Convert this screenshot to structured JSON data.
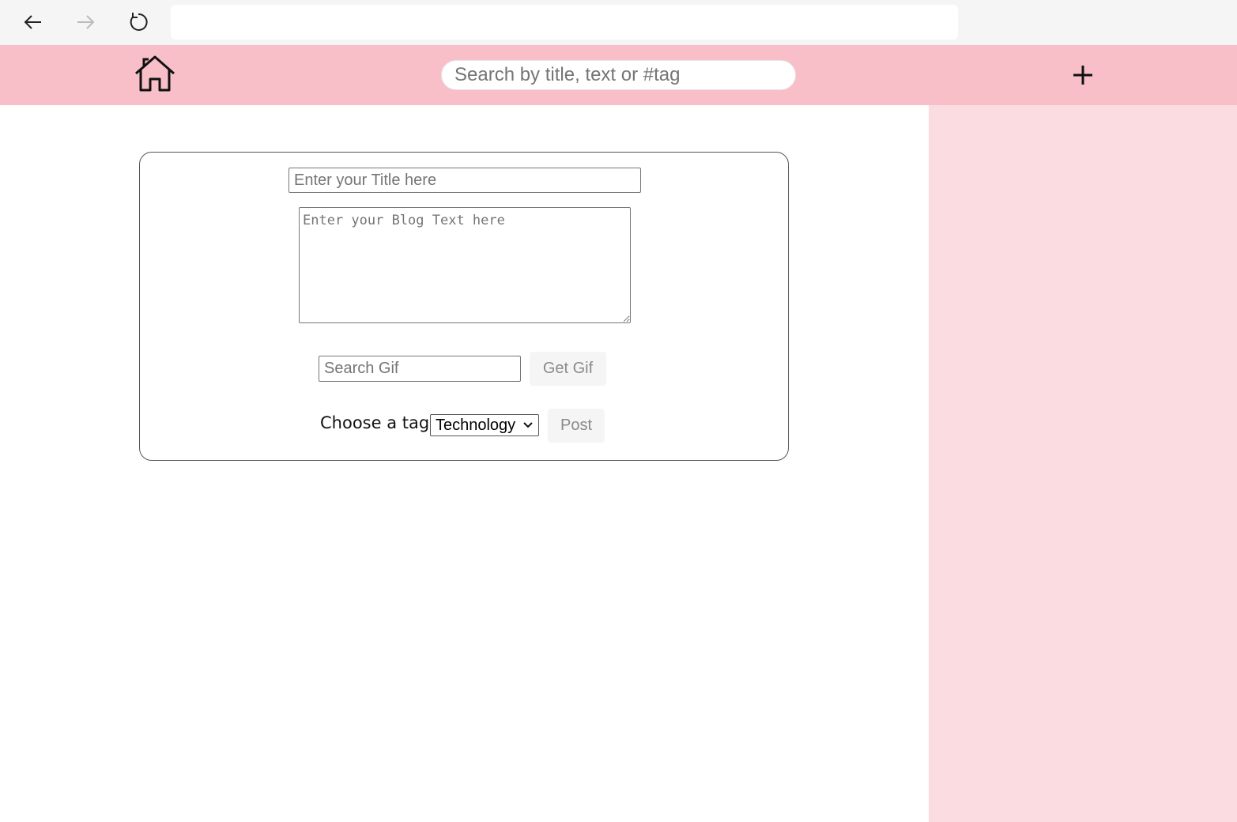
{
  "browser": {
    "back_icon": "arrow-left-icon",
    "forward_icon": "arrow-right-icon",
    "reload_icon": "reload-icon",
    "address_value": ""
  },
  "header": {
    "home_icon": "home-icon",
    "search_placeholder": "Search by title, text or #tag",
    "add_icon": "plus-icon",
    "background_color": "#f8bfc8"
  },
  "side_panel": {
    "background_color": "#fadce1"
  },
  "composer": {
    "title_placeholder": "Enter your Title here",
    "text_placeholder": "Enter your Blog Text here",
    "gif_placeholder": "Search Gif",
    "get_gif_label": "Get Gif",
    "tag_label": "Choose a tag:",
    "tag_selected": "Technology",
    "post_label": "Post"
  }
}
